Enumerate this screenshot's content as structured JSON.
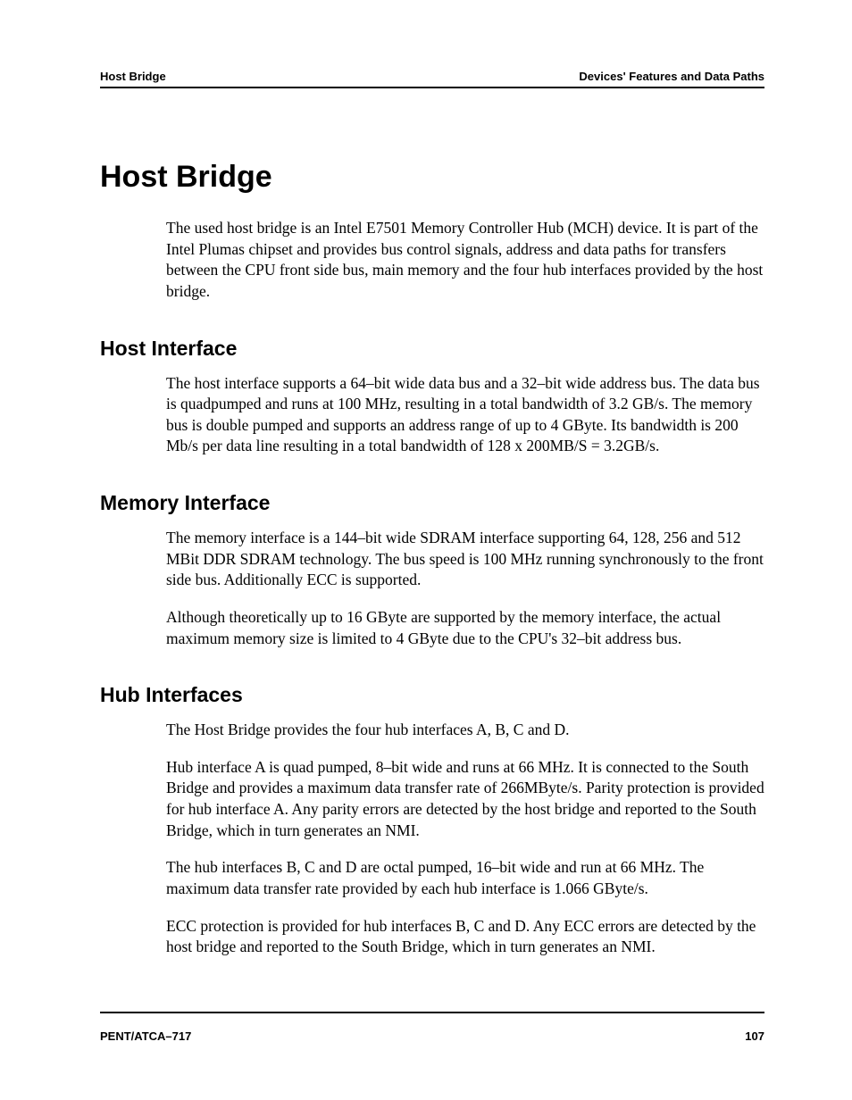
{
  "header": {
    "left": "Host Bridge",
    "right": "Devices' Features and Data Paths"
  },
  "sectionTitle": "Host Bridge",
  "intro": "The used host bridge is an Intel E7501 Memory Controller Hub (MCH) device. It is part of the Intel Plumas chipset and provides bus control signals, address and data paths for transfers between the CPU front side bus, main memory and the four hub interfaces provided by the host bridge.",
  "hostInterface": {
    "title": "Host Interface",
    "p1": "The host interface supports a 64–bit wide data bus and a 32–bit wide address bus. The data bus is quadpumped and runs at 100 MHz, resulting in a total bandwidth of 3.2 GB/s. The memory bus is double pumped and supports an address range of up to 4 GByte. Its bandwidth is 200 Mb/s per data line resulting in a total bandwidth of 128 x 200MB/S = 3.2GB/s."
  },
  "memoryInterface": {
    "title": "Memory Interface",
    "p1": "The memory interface is a 144–bit wide SDRAM interface supporting 64, 128, 256 and 512 MBit DDR SDRAM technology. The bus speed is 100 MHz running synchronously to the front side bus. Additionally ECC is supported.",
    "p2": "Although theoretically up to 16 GByte are supported by the memory interface, the actual maximum memory size is limited to 4 GByte due to the CPU's 32–bit address bus."
  },
  "hubInterfaces": {
    "title": "Hub Interfaces",
    "p1": "The Host Bridge provides the four hub interfaces A, B, C and D.",
    "p2": "Hub interface A is quad pumped, 8–bit wide and runs at 66 MHz. It is connected to the South Bridge and provides a maximum data transfer rate of 266MByte/s. Parity protection is provided for hub interface A. Any parity errors are detected by the host bridge and reported to the South Bridge, which in turn generates an NMI.",
    "p3": "The hub interfaces B, C and D are octal pumped, 16–bit wide and run at 66 MHz. The maximum data transfer rate provided by each hub interface is 1.066 GByte/s.",
    "p4": "ECC protection is provided for hub interfaces B, C and D. Any ECC errors are detected by the host bridge and reported to the South Bridge, which in turn generates an NMI."
  },
  "footer": {
    "left": "PENT/ATCA–717",
    "right": "107"
  }
}
